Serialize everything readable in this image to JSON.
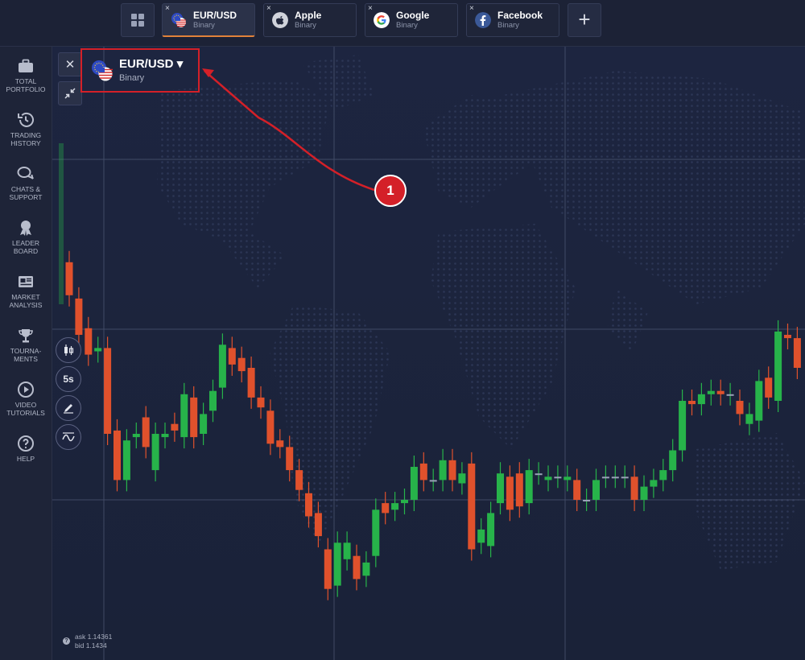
{
  "topbar": {
    "tabs": [
      {
        "name": "EUR/USD",
        "type": "Binary",
        "icon": "eur-usd-flags-icon",
        "active": true
      },
      {
        "name": "Apple",
        "type": "Binary",
        "icon": "apple-icon",
        "active": false
      },
      {
        "name": "Google",
        "type": "Binary",
        "icon": "google-icon",
        "active": false
      },
      {
        "name": "Facebook",
        "type": "Binary",
        "icon": "facebook-icon",
        "active": false
      }
    ],
    "close_glyph": "×",
    "add_label": "+"
  },
  "sidebar": {
    "items": [
      {
        "label": "TOTAL\nPORTFOLIO",
        "icon": "briefcase-icon"
      },
      {
        "label": "TRADING\nHISTORY",
        "icon": "history-icon"
      },
      {
        "label": "CHATS &\nSUPPORT",
        "icon": "chat-icon"
      },
      {
        "label": "LEADER\nBOARD",
        "icon": "award-icon"
      },
      {
        "label": "MARKET\nANALYSIS",
        "icon": "newspaper-icon"
      },
      {
        "label": "TOURNA-\nMENTS",
        "icon": "trophy-icon"
      },
      {
        "label": "VIDEO\nTUTORIALS",
        "icon": "play-icon"
      },
      {
        "label": "HELP",
        "icon": "help-icon"
      }
    ]
  },
  "chart_header": {
    "asset": "EUR/USD",
    "type": "Binary",
    "caret": "▾"
  },
  "tools": {
    "timeframe": "5s"
  },
  "annotation": {
    "marker_number": "1",
    "color": "#d42028"
  },
  "quotes": {
    "ask": "ask 1.14361",
    "bid": "bid 1.1434"
  },
  "colors": {
    "up": "#27b34a",
    "down": "#e0512c",
    "background": "#1a2238",
    "grid": "#5f6a88"
  },
  "chart_data": {
    "type": "candlestick",
    "candles": [
      {
        "dir": "down",
        "open": 0.72,
        "close": 0.62
      },
      {
        "dir": "down",
        "open": 0.61,
        "close": 0.5
      },
      {
        "dir": "down",
        "open": 0.52,
        "close": 0.44
      },
      {
        "dir": "up",
        "open": 0.45,
        "close": 0.46
      },
      {
        "dir": "down",
        "open": 0.46,
        "close": 0.2
      },
      {
        "dir": "down",
        "open": 0.21,
        "close": 0.06
      },
      {
        "dir": "up",
        "open": 0.06,
        "close": 0.18
      },
      {
        "dir": "up",
        "open": 0.19,
        "close": 0.2
      },
      {
        "dir": "down",
        "open": 0.25,
        "close": 0.16
      },
      {
        "dir": "up",
        "open": 0.09,
        "close": 0.2
      },
      {
        "dir": "up",
        "open": 0.19,
        "close": 0.2
      },
      {
        "dir": "down",
        "open": 0.23,
        "close": 0.21
      },
      {
        "dir": "up",
        "open": 0.19,
        "close": 0.32
      },
      {
        "dir": "down",
        "open": 0.31,
        "close": 0.19
      },
      {
        "dir": "up",
        "open": 0.2,
        "close": 0.26
      },
      {
        "dir": "up",
        "open": 0.27,
        "close": 0.33
      },
      {
        "dir": "up",
        "open": 0.34,
        "close": 0.47
      },
      {
        "dir": "down",
        "open": 0.46,
        "close": 0.41
      },
      {
        "dir": "down",
        "open": 0.43,
        "close": 0.39
      },
      {
        "dir": "down",
        "open": 0.4,
        "close": 0.31
      },
      {
        "dir": "down",
        "open": 0.31,
        "close": 0.28
      },
      {
        "dir": "down",
        "open": 0.27,
        "close": 0.17
      },
      {
        "dir": "down",
        "open": 0.18,
        "close": 0.16
      },
      {
        "dir": "down",
        "open": 0.16,
        "close": 0.09
      },
      {
        "dir": "down",
        "open": 0.09,
        "close": 0.03
      },
      {
        "dir": "down",
        "open": 0.02,
        "close": -0.05
      },
      {
        "dir": "down",
        "open": -0.04,
        "close": -0.11
      },
      {
        "dir": "down",
        "open": -0.15,
        "close": -0.27
      },
      {
        "dir": "up",
        "open": -0.26,
        "close": -0.13
      },
      {
        "dir": "up",
        "open": -0.18,
        "close": -0.13
      },
      {
        "dir": "down",
        "open": -0.17,
        "close": -0.24
      },
      {
        "dir": "up",
        "open": -0.23,
        "close": -0.19
      },
      {
        "dir": "up",
        "open": -0.17,
        "close": -0.03
      },
      {
        "dir": "down",
        "open": -0.01,
        "close": -0.04
      },
      {
        "dir": "up",
        "open": -0.03,
        "close": -0.01
      },
      {
        "dir": "up",
        "open": -0.01,
        "close": 0.0
      },
      {
        "dir": "up",
        "open": 0.0,
        "close": 0.1
      },
      {
        "dir": "down",
        "open": 0.11,
        "close": 0.06
      },
      {
        "dir": "up",
        "open": 0.06,
        "close": 0.06
      },
      {
        "dir": "up",
        "open": 0.06,
        "close": 0.12
      },
      {
        "dir": "down",
        "open": 0.12,
        "close": 0.06
      },
      {
        "dir": "up",
        "open": 0.05,
        "close": 0.08
      },
      {
        "dir": "down",
        "open": 0.11,
        "close": -0.15
      },
      {
        "dir": "up",
        "open": -0.13,
        "close": -0.09
      },
      {
        "dir": "up",
        "open": -0.14,
        "close": -0.04
      },
      {
        "dir": "up",
        "open": -0.01,
        "close": 0.08
      },
      {
        "dir": "down",
        "open": 0.07,
        "close": -0.03
      },
      {
        "dir": "down",
        "open": 0.08,
        "close": -0.02
      },
      {
        "dir": "up",
        "open": -0.01,
        "close": 0.09
      },
      {
        "dir": "up",
        "open": 0.08,
        "close": 0.08
      },
      {
        "dir": "up",
        "open": 0.07,
        "close": 0.06
      },
      {
        "dir": "up",
        "open": 0.07,
        "close": 0.07
      },
      {
        "dir": "up",
        "open": 0.07,
        "close": 0.06
      },
      {
        "dir": "down",
        "open": 0.06,
        "close": 0.0
      },
      {
        "dir": "up",
        "open": 0.0,
        "close": 0.0
      },
      {
        "dir": "up",
        "open": 0.0,
        "close": 0.06
      },
      {
        "dir": "up",
        "open": 0.07,
        "close": 0.07
      },
      {
        "dir": "up",
        "open": 0.07,
        "close": 0.07
      },
      {
        "dir": "up",
        "open": 0.07,
        "close": 0.07
      },
      {
        "dir": "down",
        "open": 0.07,
        "close": 0.0
      },
      {
        "dir": "up",
        "open": 0.0,
        "close": 0.04
      },
      {
        "dir": "up",
        "open": 0.04,
        "close": 0.06
      },
      {
        "dir": "up",
        "open": 0.06,
        "close": 0.09
      },
      {
        "dir": "up",
        "open": 0.09,
        "close": 0.15
      },
      {
        "dir": "up",
        "open": 0.15,
        "close": 0.3
      },
      {
        "dir": "down",
        "open": 0.3,
        "close": 0.29
      },
      {
        "dir": "up",
        "open": 0.29,
        "close": 0.32
      },
      {
        "dir": "up",
        "open": 0.32,
        "close": 0.33
      },
      {
        "dir": "down",
        "open": 0.33,
        "close": 0.32
      },
      {
        "dir": "up",
        "open": 0.32,
        "close": 0.32
      },
      {
        "dir": "down",
        "open": 0.3,
        "close": 0.26
      },
      {
        "dir": "up",
        "open": 0.23,
        "close": 0.26
      },
      {
        "dir": "up",
        "open": 0.24,
        "close": 0.36
      },
      {
        "dir": "down",
        "open": 0.37,
        "close": 0.31
      },
      {
        "dir": "up",
        "open": 0.3,
        "close": 0.51
      },
      {
        "dir": "down",
        "open": 0.5,
        "close": 0.49
      },
      {
        "dir": "down",
        "open": 0.49,
        "close": 0.4
      }
    ]
  }
}
